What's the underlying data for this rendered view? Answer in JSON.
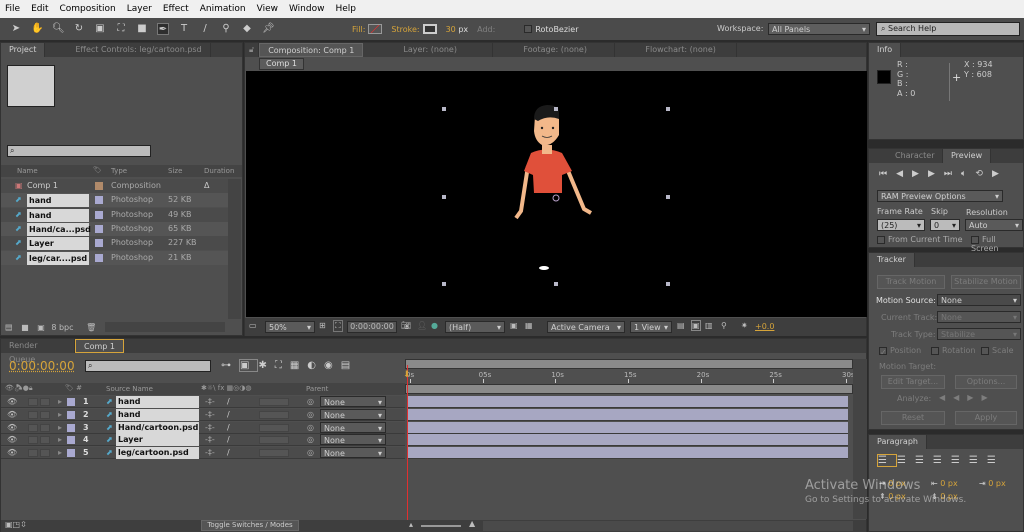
{
  "menu": [
    "File",
    "Edit",
    "Composition",
    "Layer",
    "Effect",
    "Animation",
    "View",
    "Window",
    "Help"
  ],
  "toolbar": {
    "fill_label": "Fill:",
    "stroke_label": "Stroke:",
    "stroke_width": "30",
    "stroke_unit": "px",
    "add_label": "Add:",
    "rotobezier": "RotoBezier",
    "workspace_label": "Workspace:",
    "workspace_value": "All Panels",
    "search_placeholder": "Search Help"
  },
  "project": {
    "tabs": [
      "Project",
      "Effect Controls: leg/cartoon.psd"
    ],
    "columns": [
      "Name",
      "Type",
      "Size",
      "Duration"
    ],
    "items": [
      {
        "name": "Comp 1",
        "type": "Composition",
        "size": "",
        "duration": "Δ 0:00",
        "color": "#b08a6a"
      },
      {
        "name": "hand 01....psd",
        "type": "Photoshop",
        "size": "52 KB",
        "duration": "",
        "color": "#a9a9d0"
      },
      {
        "name": "hand 02....psd",
        "type": "Photoshop",
        "size": "49 KB",
        "duration": "",
        "color": "#a9a9d0"
      },
      {
        "name": "Hand/ca...psd",
        "type": "Photoshop",
        "size": "65 KB",
        "duration": "",
        "color": "#a9a9d0"
      },
      {
        "name": "Layer 1....psd",
        "type": "Photoshop",
        "size": "227 KB",
        "duration": "",
        "color": "#a9a9d0"
      },
      {
        "name": "leg/car....psd",
        "type": "Photoshop",
        "size": "21 KB",
        "duration": "",
        "color": "#a9a9d0"
      }
    ],
    "bpc": "8 bpc"
  },
  "viewer": {
    "tabs": [
      "Composition: Comp 1",
      "Layer: (none)",
      "Footage: (none)",
      "Flowchart: (none)"
    ],
    "comp_button": "Comp 1",
    "zoom": "50%",
    "timecode": "0:00:00:00",
    "resolution": "(Half)",
    "camera": "Active Camera",
    "views": "1 View",
    "exposure": "+0.0"
  },
  "info": {
    "tab": "Info",
    "r": "R :",
    "g": "G :",
    "b": "B :",
    "a": "A : 0",
    "x": "X : 934",
    "y": "Y : 608"
  },
  "preview": {
    "tabs": [
      "Character",
      "Preview"
    ],
    "ram": "RAM Preview Options",
    "frame_rate_label": "Frame Rate",
    "frame_rate": "(25)",
    "skip_label": "Skip",
    "skip": "0",
    "resolution_label": "Resolution",
    "resolution": "Auto",
    "from_current": "From Current Time",
    "full_screen": "Full Screen"
  },
  "tracker": {
    "tab": "Tracker",
    "track_motion": "Track Motion",
    "stabilize_motion": "Stabilize Motion",
    "motion_source_label": "Motion Source:",
    "motion_source": "None",
    "current_track_label": "Current Track:",
    "current_track": "None",
    "track_type_label": "Track Type:",
    "track_type": "Stabilize",
    "position": "Position",
    "rotation": "Rotation",
    "scale": "Scale",
    "motion_target": "Motion Target:",
    "edit_target": "Edit Target...",
    "options": "Options...",
    "analyze": "Analyze:",
    "reset": "Reset",
    "apply": "Apply"
  },
  "paragraph": {
    "tab": "Paragraph",
    "values": [
      "0 px",
      "0 px",
      "0 px",
      "0 px",
      "0 px"
    ]
  },
  "timeline": {
    "tabs": [
      "Render Queue",
      "Comp 1"
    ],
    "timecode": "0:00:00:00",
    "columns": {
      "source": "Source Name",
      "parent": "Parent"
    },
    "ruler": [
      "0s",
      "05s",
      "10s",
      "15s",
      "20s",
      "25s",
      "30s"
    ],
    "duration_s": 30,
    "current_time_s": 0,
    "layers": [
      {
        "num": "1",
        "name": "hand 01...oon.psd",
        "parent": "None"
      },
      {
        "num": "2",
        "name": "hand 02...oon.psd",
        "parent": "None"
      },
      {
        "num": "3",
        "name": "Hand/cartoon.psd",
        "parent": "None"
      },
      {
        "num": "4",
        "name": "Layer 1...toon.psd",
        "parent": "None"
      },
      {
        "num": "5",
        "name": "leg/cartoon.psd",
        "parent": "None"
      }
    ],
    "toggle": "Toggle Switches / Modes"
  },
  "watermark": {
    "line1": "Activate Windows",
    "line2": "Go to Settings to activate Windows."
  },
  "colors": {
    "accent": "#d6a43a",
    "playhead": "#e03030",
    "layer_bar": "#a7a7c2"
  }
}
